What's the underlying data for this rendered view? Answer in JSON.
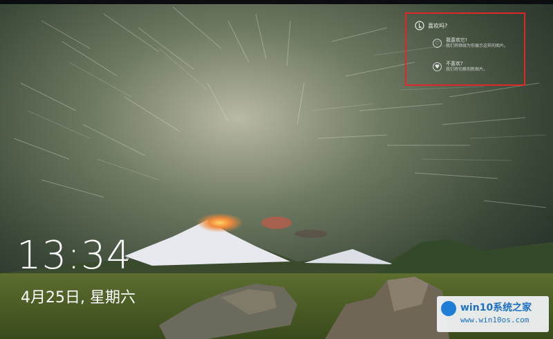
{
  "lockscreen": {
    "time": "13:34",
    "date": "4月25日, 星期六"
  },
  "spotlight": {
    "question": "喜欢吗?",
    "like": {
      "title": "我喜欢它!",
      "desc": "我们将继续为你展示这样的图片。",
      "icon": "heart-outline-icon"
    },
    "dislike": {
      "title": "不喜欢?",
      "desc": "我们将切换到新图片。",
      "icon": "heart-broken-icon"
    }
  },
  "watermark": {
    "title": "win10系统之家",
    "url": "www.win10os.com"
  },
  "colors": {
    "highlight_border": "#e0262b",
    "watermark_blue": "#1b6fc4"
  }
}
